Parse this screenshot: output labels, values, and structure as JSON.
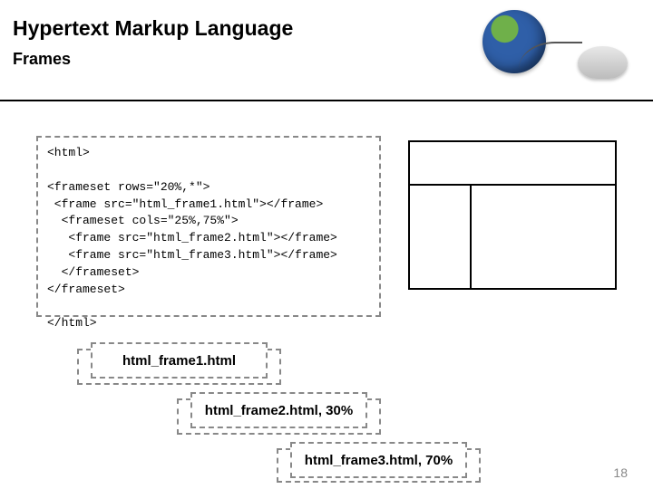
{
  "header": {
    "title": "Hypertext Markup Language",
    "subtitle": "Frames"
  },
  "code": {
    "lines": [
      "<html>",
      "",
      "<frameset rows=\"20%,*\">",
      " <frame src=\"html_frame1.html\"></frame>",
      "  <frameset cols=\"25%,75%\">",
      "   <frame src=\"html_frame2.html\"></frame>",
      "   <frame src=\"html_frame3.html\"></frame>",
      "  </frameset>",
      "</frameset>",
      "",
      "</html>"
    ]
  },
  "captions": {
    "c1": "html_frame1.html",
    "c2": "html_frame2.html, 30%",
    "c3": "html_frame3.html, 70%"
  },
  "page_number": "18"
}
